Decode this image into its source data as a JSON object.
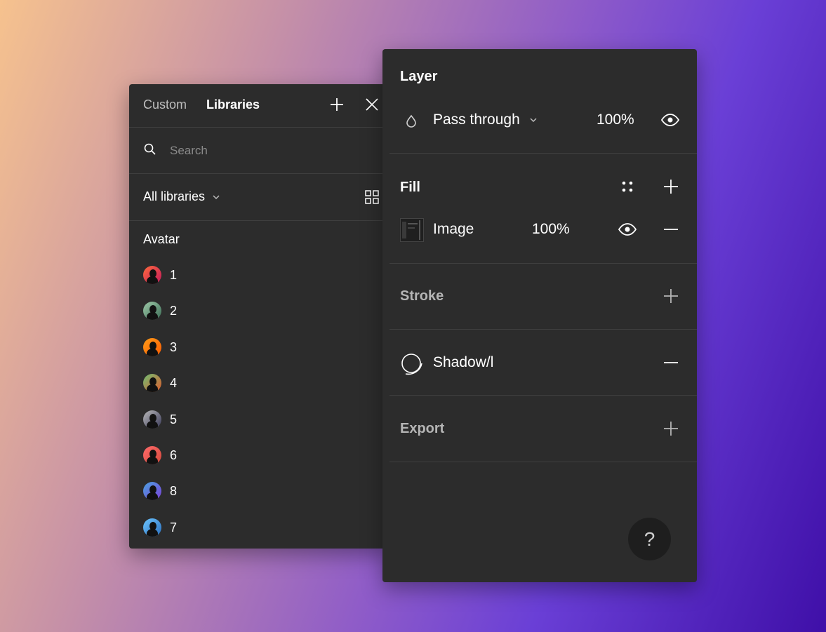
{
  "libraries_panel": {
    "tabs": [
      "Custom",
      "Libraries"
    ],
    "search_placeholder": "Search",
    "filter_label": "All libraries",
    "section_title": "Avatar",
    "items": [
      {
        "label": "1",
        "colors": [
          "#ff6a3d",
          "#c2185b"
        ]
      },
      {
        "label": "2",
        "colors": [
          "#9ec9a8",
          "#3c6e57"
        ]
      },
      {
        "label": "3",
        "colors": [
          "#ff9d1a",
          "#ff5a00"
        ]
      },
      {
        "label": "4",
        "colors": [
          "#6fbf73",
          "#e05a2b"
        ]
      },
      {
        "label": "5",
        "colors": [
          "#b8b8b8",
          "#3a3a5a"
        ]
      },
      {
        "label": "6",
        "colors": [
          "#ff6b6b",
          "#d4483b"
        ]
      },
      {
        "label": "8",
        "colors": [
          "#4aa3df",
          "#7b3fd9"
        ]
      },
      {
        "label": "7",
        "colors": [
          "#6ec6ff",
          "#2a6fbf"
        ]
      }
    ]
  },
  "properties_panel": {
    "layer": {
      "title": "Layer",
      "blend_mode": "Pass through",
      "opacity": "100%"
    },
    "fill": {
      "title": "Fill",
      "type": "Image",
      "opacity": "100%"
    },
    "stroke": {
      "title": "Stroke"
    },
    "effect": {
      "name": "Shadow/l"
    },
    "export": {
      "title": "Export"
    },
    "help_label": "?"
  },
  "colors": {
    "panel_bg": "#2c2c2c",
    "divider": "#3f3f3f",
    "text_dim": "#b5b5b5"
  }
}
